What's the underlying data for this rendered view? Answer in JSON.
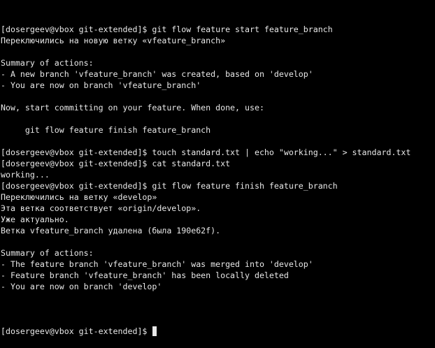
{
  "terminal": {
    "lines": [
      "[dosergeev@vbox git-extended]$ git flow feature start feature_branch",
      "Переключились на новую ветку «vfeature_branch»",
      "",
      "Summary of actions:",
      "- A new branch 'vfeature_branch' was created, based on 'develop'",
      "- You are now on branch 'vfeature_branch'",
      "",
      "Now, start committing on your feature. When done, use:",
      "",
      "     git flow feature finish feature_branch",
      "",
      "[dosergeev@vbox git-extended]$ touch standard.txt | echo \"working...\" > standard.txt",
      "[dosergeev@vbox git-extended]$ cat standard.txt",
      "working...",
      "[dosergeev@vbox git-extended]$ git flow feature finish feature_branch",
      "Переключились на ветку «develop»",
      "Эта ветка соответствует «origin/develop».",
      "Уже актуально.",
      "Ветка vfeature_branch удалена (была 190e62f).",
      "",
      "Summary of actions:",
      "- The feature branch 'vfeature_branch' was merged into 'develop'",
      "- Feature branch 'vfeature_branch' has been locally deleted",
      "- You are now on branch 'develop'",
      ""
    ],
    "prompt": "[dosergeev@vbox git-extended]$ "
  }
}
